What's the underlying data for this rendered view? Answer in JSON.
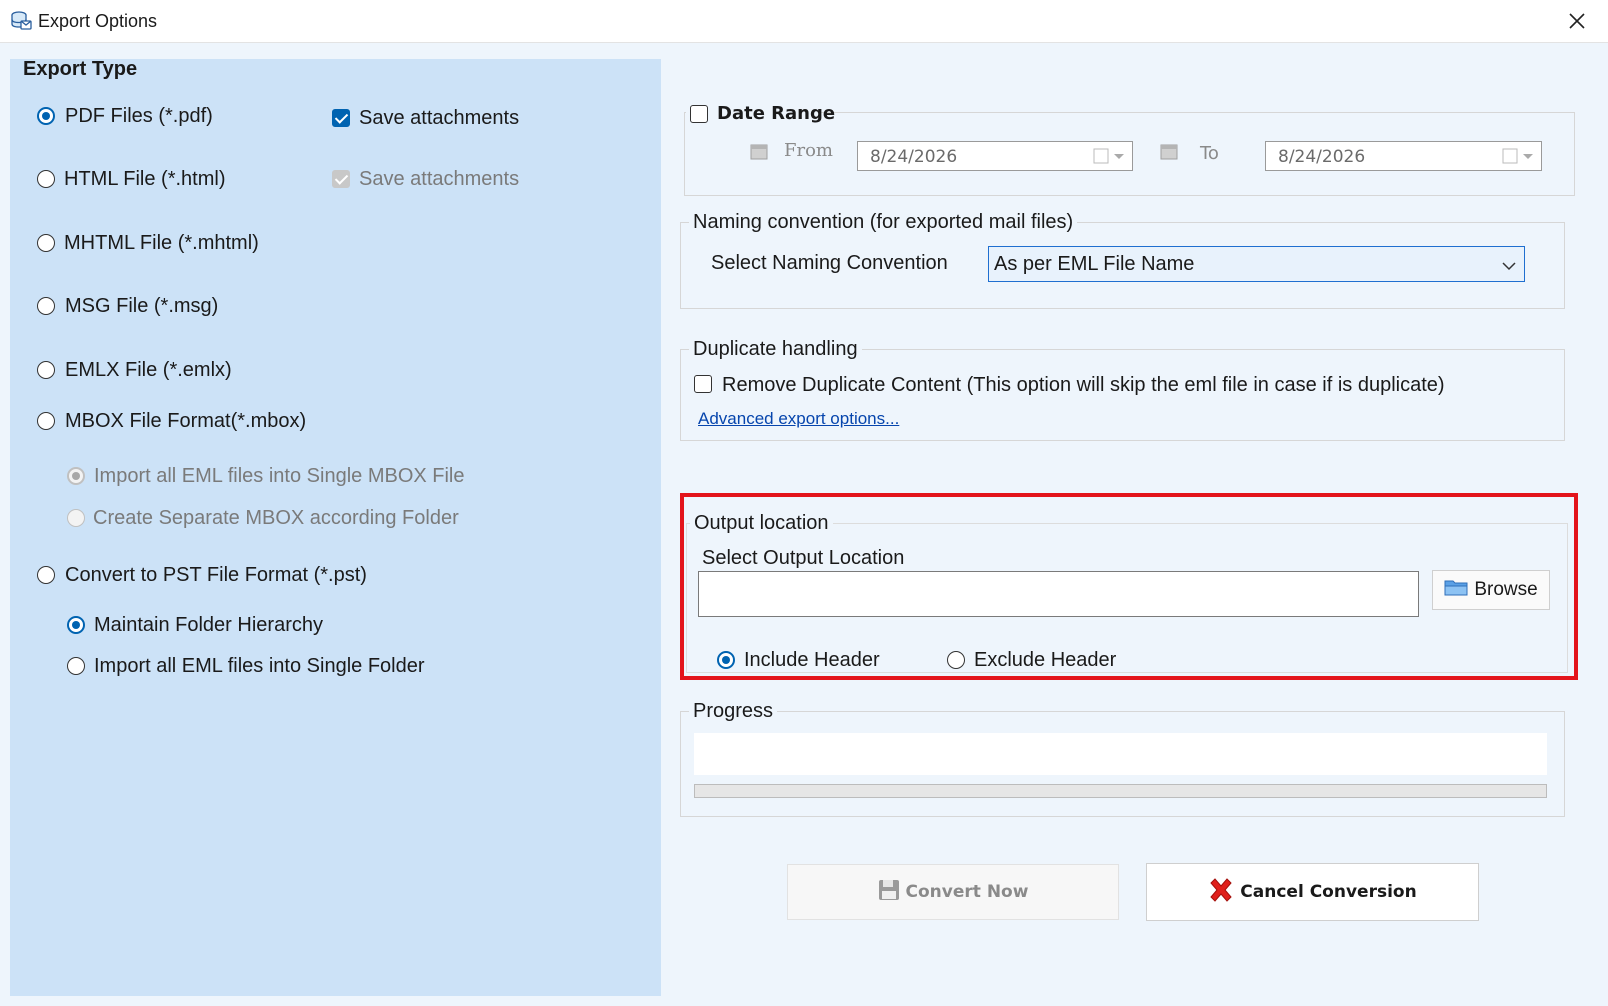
{
  "window": {
    "title": "Export Options",
    "close_glyph": "✕"
  },
  "export_type": {
    "heading": "Export Type",
    "options": [
      {
        "label": "PDF Files (*.pdf)",
        "selected": true
      },
      {
        "label": "HTML File  (*.html)",
        "selected": false
      },
      {
        "label": "MHTML File  (*.mhtml)",
        "selected": false
      },
      {
        "label": "MSG File (*.msg)",
        "selected": false
      },
      {
        "label": "EMLX File (*.emlx)",
        "selected": false
      },
      {
        "label": "MBOX File Format(*.mbox)",
        "selected": false
      },
      {
        "label": "Convert to PST File Format (*.pst)",
        "selected": false
      }
    ],
    "pdf_save_attachments": {
      "label": "Save attachments",
      "checked": true
    },
    "html_save_attachments": {
      "label": "Save attachments",
      "checked": true,
      "disabled": true
    },
    "mbox_suboptions": [
      {
        "label": "Import all EML files into Single MBOX File",
        "selected": true,
        "disabled": true
      },
      {
        "label": "Create Separate MBOX according Folder",
        "selected": false,
        "disabled": true
      }
    ],
    "pst_suboptions": [
      {
        "label": "Maintain Folder Hierarchy",
        "selected": true
      },
      {
        "label": "Import all EML files into Single Folder",
        "selected": false
      }
    ]
  },
  "date_range": {
    "label": "Date Range",
    "checked": false,
    "from_label": "From",
    "to_label": "To",
    "from_value": "8/24/2026",
    "to_value": "8/24/2026"
  },
  "naming": {
    "group_title": "Naming convention (for exported mail files)",
    "select_label": "Select Naming Convention",
    "selected_value": "As per EML File Name"
  },
  "duplicate": {
    "group_title": "Duplicate handling",
    "checkbox_label": "Remove Duplicate Content (This option will skip the eml file in case if is duplicate)",
    "checked": false,
    "advanced_link": "Advanced export options..."
  },
  "output": {
    "group_title": "Output location",
    "select_label": "Select Output Location",
    "path_value": "",
    "browse_label": "Browse",
    "include_header": "Include Header",
    "exclude_header": "Exclude Header",
    "header_choice": "include",
    "highlight_color": "#e3141b"
  },
  "progress": {
    "group_title": "Progress",
    "status_text": "",
    "value": 0
  },
  "buttons": {
    "convert": "Convert Now",
    "cancel": "Cancel Conversion"
  },
  "colors": {
    "left_panel": "#cce2f7",
    "client_bg": "#eef5fc",
    "accent": "#0063b1"
  }
}
